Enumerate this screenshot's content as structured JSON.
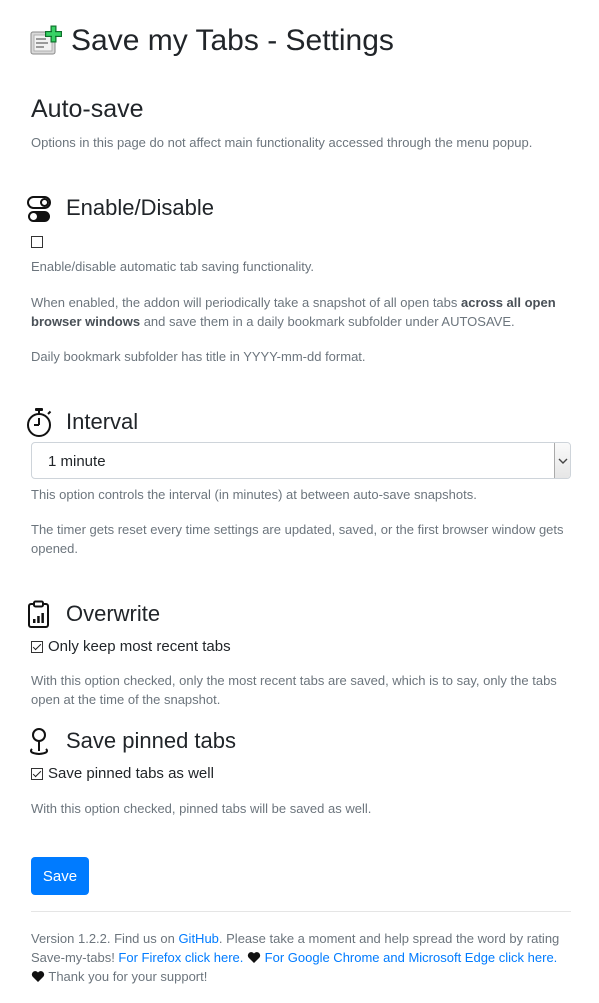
{
  "header": {
    "title": "Save my Tabs - Settings"
  },
  "page": {
    "heading": "Auto-save",
    "intro": "Options in this page do not affect main functionality accessed through the menu popup."
  },
  "enable": {
    "title": "Enable/Disable",
    "checked": false,
    "desc1": "Enable/disable automatic tab saving functionality.",
    "desc2_part1": "When enabled, the addon will periodically take a snapshot of all open tabs ",
    "desc2_bold": "across all open browser windows",
    "desc2_part2": " and save them in a daily bookmark subfolder under AUTOSAVE.",
    "desc3": "Daily bookmark subfolder has title in YYYY-mm-dd format."
  },
  "interval": {
    "title": "Interval",
    "selected": "1 minute",
    "desc1": "This option controls the interval (in minutes) at between auto-save snapshots.",
    "desc2": "The timer gets reset every time settings are updated, saved, or the first browser window gets opened."
  },
  "overwrite": {
    "title": "Overwrite",
    "checkbox_label": "Only keep most recent tabs",
    "checked": true,
    "desc": "With this option checked, only the most recent tabs are saved, which is to say, only the tabs open at the time of the snapshot."
  },
  "pinned": {
    "title": "Save pinned tabs",
    "checkbox_label": "Save pinned tabs as well",
    "checked": true,
    "desc": "With this option checked, pinned tabs will be saved as well."
  },
  "actions": {
    "save_label": "Save"
  },
  "footer": {
    "text1": "Version 1.2.2. Find us on ",
    "github_link": "GitHub",
    "text2": ". Please take a moment and help spread the word by rating Save-my-tabs! ",
    "firefox_link": "For Firefox click here.",
    "chrome_link": "For Google Chrome and Microsoft Edge click here.",
    "thanks": "Thank you for your support!"
  },
  "colors": {
    "accent": "#007bff",
    "muted": "#6c757d",
    "text": "#212529"
  }
}
